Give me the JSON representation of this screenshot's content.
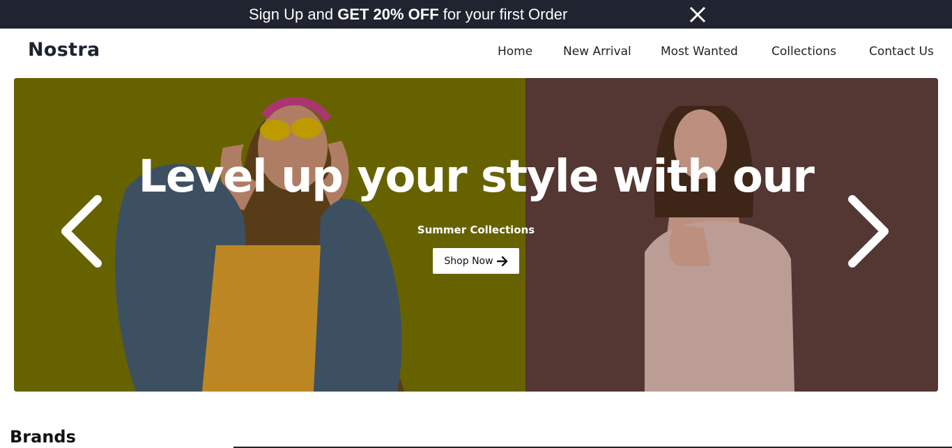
{
  "promo": {
    "text_before": "Sign Up and ",
    "text_bold": "GET 20% OFF",
    "text_after": " for your first Order",
    "close_icon": "close-icon"
  },
  "header": {
    "brand": "Nostra",
    "nav": [
      "Home",
      "New Arrival",
      "Most Wanted",
      "Collections",
      "Contact Us"
    ]
  },
  "hero": {
    "headline": "Level up your style with our",
    "subtitle": "Summer Collections",
    "cta_label": "Shop Now",
    "cta_icon": "arrow-right-icon",
    "prev_icon": "chevron-left-icon",
    "next_icon": "chevron-right-icon"
  },
  "brands": {
    "title": "Brands"
  },
  "colors": {
    "promo_bg": "#1f2430",
    "hero_left": "#716f00",
    "hero_right": "#5a3a3f",
    "brand_text": "#1c2230"
  }
}
